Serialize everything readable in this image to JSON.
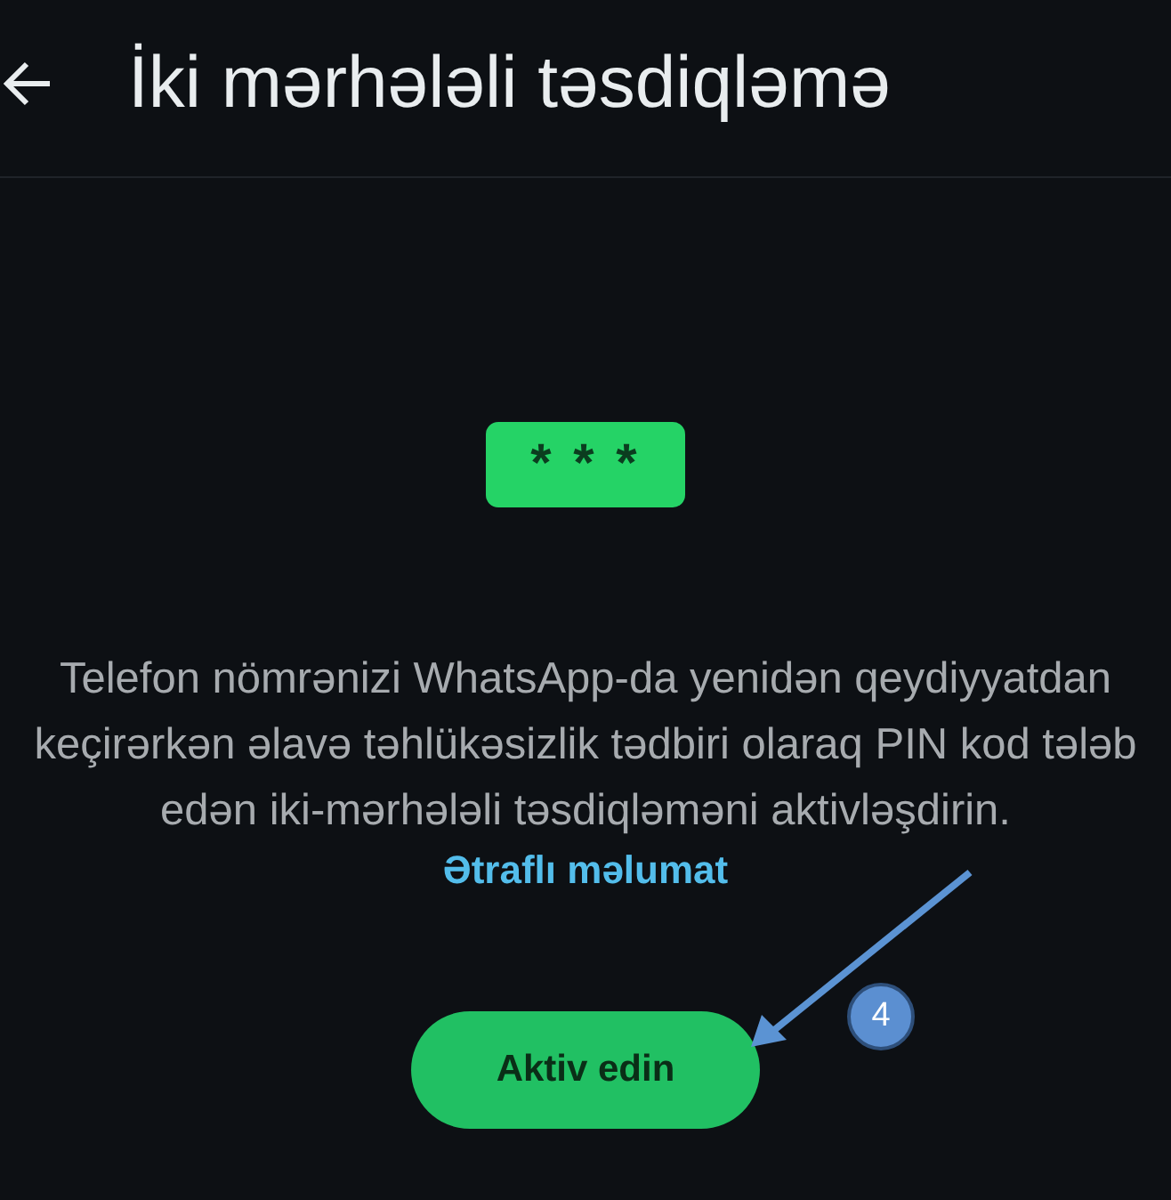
{
  "header": {
    "title": "İki mərhələli təsdiqləmə"
  },
  "pin_badge": "* * *",
  "description": "Telefon nömrənizi WhatsApp-da yenidən qeydiyyatdan keçirərkən əlavə təhlükəsizlik tədbiri olaraq PIN kod tələb edən iki-mərhələli təsdiqləməni aktivləşdirin.",
  "link": "Ətraflı məlumat",
  "button": "Aktiv edin",
  "annotation": {
    "step": "4"
  }
}
